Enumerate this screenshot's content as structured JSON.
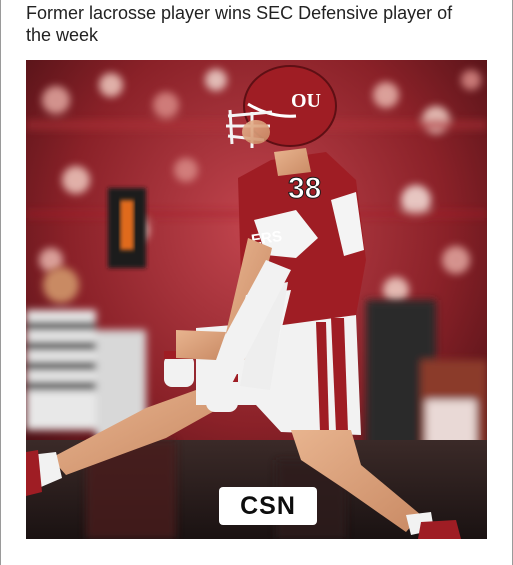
{
  "post": {
    "headline": "Former lacrosse player wins SEC Defensive player of the week",
    "image": {
      "jersey_number": "38",
      "helmet_logo": "OU",
      "badge": "CSN"
    }
  }
}
